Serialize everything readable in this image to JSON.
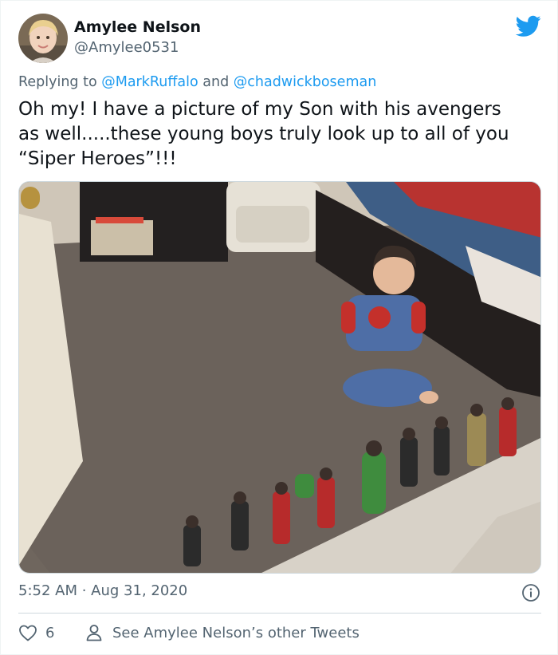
{
  "user": {
    "display_name": "Amylee Nelson",
    "handle": "@Amylee0531"
  },
  "reply": {
    "prefix": "Replying to ",
    "mention_1": "@MarkRuffalo",
    "joiner": " and ",
    "mention_2": "@chadwickboseman"
  },
  "tweet": {
    "text": "Oh my! I have a picture of my Son with his avengers\nas well.....these young boys truly look up to all of you\n“Siper Heroes”!!!"
  },
  "meta": {
    "time": "5:52 AM",
    "separator": " · ",
    "date": "Aug 31, 2020"
  },
  "actions": {
    "like_count": "6",
    "see_more_label": "See Amylee Nelson’s other Tweets"
  },
  "colors": {
    "brand_blue": "#1d9bf0",
    "secondary_text": "#536471",
    "primary_text": "#0f1419"
  },
  "icons": [
    "avatar-photo",
    "twitter-bird-icon",
    "info-icon",
    "heart-icon",
    "profile-icon"
  ]
}
